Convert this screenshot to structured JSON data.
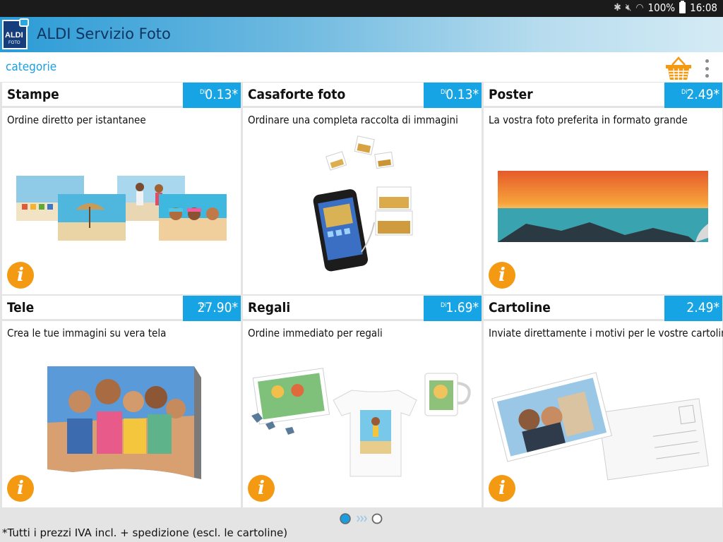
{
  "status_bar": {
    "battery": "100%",
    "time": "16:08"
  },
  "app": {
    "title": "ALDI Servizio Foto",
    "logo_top": "ALDI",
    "logo_bottom": "FOTO"
  },
  "toolbar": {
    "categories_label": "categorie"
  },
  "tiles": [
    {
      "name": "Stampe",
      "prefix": "Di",
      "price": "0.13*",
      "desc": "Ordine diretto per istantanee",
      "info": "i"
    },
    {
      "name": "Casaforte foto",
      "prefix": "Di",
      "price": "0.13*",
      "desc": "Ordinare una completa raccolta di immagini",
      "info": "i"
    },
    {
      "name": "Poster",
      "prefix": "Di",
      "price": "2.49*",
      "desc": "La vostra foto preferita in formato grande",
      "info": "i"
    },
    {
      "name": "Tele",
      "prefix": "Di",
      "price": "27.90*",
      "desc": "Crea le tue immagini su vera tela",
      "info": "i"
    },
    {
      "name": "Regali",
      "prefix": "Di",
      "price": "1.69*",
      "desc": "Ordine immediato per regali",
      "info": "i"
    },
    {
      "name": "Cartoline",
      "prefix": "",
      "price": "2.49*",
      "desc": "Inviate direttamente i motivi per le vostre cartoline",
      "info": "i"
    }
  ],
  "pager": {
    "current_page": 1,
    "total_pages": 2
  },
  "footer": {
    "note": "*Tutti i prezzi IVA incl. + spedizione (escl. le cartoline)"
  },
  "colors": {
    "accent": "#16a4e4",
    "info": "#f39a12",
    "app_dark": "#163e7c"
  }
}
